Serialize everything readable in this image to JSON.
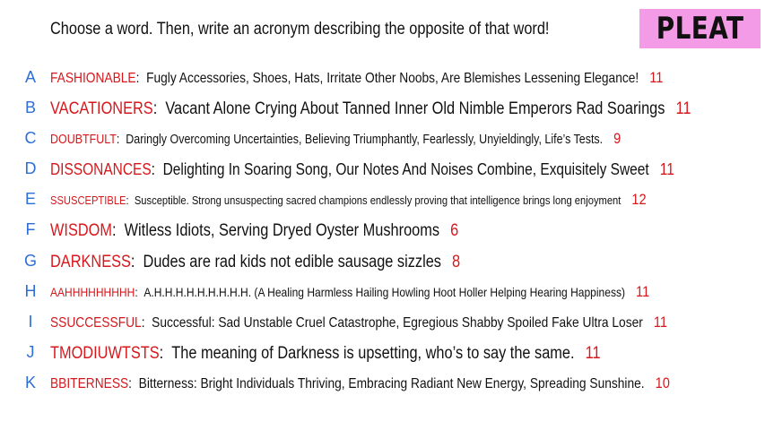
{
  "prompt": "Choose a word. Then, write an acronym describing the opposite of that word!",
  "logo": "PLEAT",
  "colors": {
    "letter": "#2c6fd6",
    "word": "#d6181d",
    "number": "#d6181d",
    "logo_bg": "#f39be6"
  },
  "rows": [
    {
      "letter": "A",
      "word": "FASHIONABLE",
      "acronym": "Fugly Accessories, Shoes, Hats, Irritate Other Noobs, Are Blemishes Lessening Elegance!",
      "score": "11"
    },
    {
      "letter": "B",
      "word": "VACATIONERS",
      "acronym": "Vacant Alone Crying About Tanned Inner Old Nimble Emperors Rad Soarings",
      "score": "11"
    },
    {
      "letter": "C",
      "word": "DOUBTFULT",
      "acronym": "Daringly Overcoming Uncertainties, Believing Triumphantly, Fearlessly, Unyieldingly, Life’s Tests.",
      "score": "9"
    },
    {
      "letter": "D",
      "word": "DISSONANCES",
      "acronym": "Delighting In Soaring Song, Our Notes And Noises Combine, Exquisitely Sweet",
      "score": "11"
    },
    {
      "letter": "E",
      "word": "SSUSCEPTIBLE",
      "acronym": "Susceptible. Strong unsuspecting sacred champions endlessly proving that intelligence brings long enjoyment",
      "score": "12"
    },
    {
      "letter": "F",
      "word": "WISDOM",
      "acronym": "Witless Idiots, Serving Dryed Oyster Mushrooms",
      "score": "6"
    },
    {
      "letter": "G",
      "word": "DARKNESS",
      "acronym": "Dudes are rad kids not edible sausage sizzles",
      "score": "8"
    },
    {
      "letter": "H",
      "word": "AAHHHHHHHHH",
      "acronym": "A.H.H.H.H.H.H.H.H.H. (A Healing Harmless Hailing Howling Hoot Holler Helping Hearing Happiness)",
      "score": "11"
    },
    {
      "letter": "I",
      "word": "SSUCCESSFUL",
      "acronym": "Successful: Sad Unstable Cruel Catastrophe, Egregious Shabby Spoiled Fake Ultra Loser",
      "score": "11"
    },
    {
      "letter": "J",
      "word": "TMODIUWTSTS",
      "acronym": "The meaning of Darkness is upsetting, who’s to say the same.",
      "score": "11"
    },
    {
      "letter": "K",
      "word": "BBITERNESS",
      "acronym": "Bitterness: Bright Individuals Thriving, Embracing Radiant New Energy, Spreading Sunshine.",
      "score": "10"
    }
  ]
}
